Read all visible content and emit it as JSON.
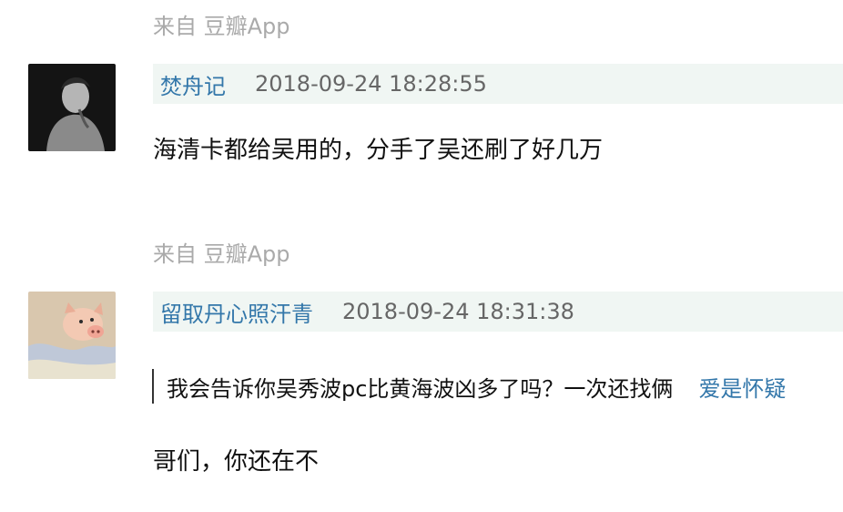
{
  "comments": [
    {
      "source": "来自 豆瓣App",
      "username": "焚舟记",
      "timestamp": "2018-09-24 18:28:55",
      "avatar_icon": "woman-silhouette-avatar",
      "content": "海清卡都给吴用的，分手了吴还刷了好几万"
    },
    {
      "source": "来自 豆瓣App",
      "username": "留取丹心照汗青",
      "timestamp": "2018-09-24 18:31:38",
      "avatar_icon": "piglet-avatar",
      "quote": {
        "text": "我会告诉你吴秀波pc比黄海波凶多了吗？一次还找俩",
        "author": "爱是怀疑"
      },
      "content": "哥们，你还在不"
    }
  ],
  "colors": {
    "link": "#3377aa",
    "meta_bg": "#f0f6f3",
    "muted": "#aaaaaa"
  }
}
